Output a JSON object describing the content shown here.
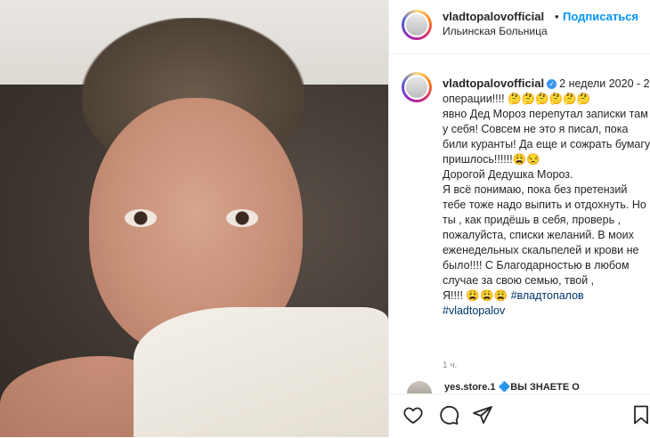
{
  "post": {
    "username": "vladtopalovofficial",
    "separator": "•",
    "follow_label": "Подписаться",
    "location": "Ильинская Больница",
    "caption_prefix": "2 недели 2020 - 2 операции!!!! 🤔🤔🤔🤔🤔🤔",
    "caption_body": "явно Дед Мороз перепутал записки там у себя! Совсем не это я писал, пока били куранты! Да еще и сожрать бумагу пришлось!!!!!!😩😒\nДорогой Дедушка Мороз.\nЯ всё понимаю, пока без претензий тебе тоже надо выпить и отдохнуть. Но ты , как придёшь в себя, проверь , пожалуйста, списки желаний. В моих еженедельных скальпелей и крови не было!!!! С Благодарностью в любом случае за свою семью, твой ,\nЯ!!!! 😩😩😩 ",
    "tag1": "#владтопалов",
    "tag2": "#vladtopalov",
    "time_ago": "1 ч."
  },
  "comment": {
    "username": "yes.store.1",
    "text": "🔷ВЫ ЗНАЕТЕ О"
  },
  "icons": {
    "like": "heart-icon",
    "comment": "comment-icon",
    "share": "share-icon",
    "save": "bookmark-icon"
  },
  "colors": {
    "link": "#0095f6",
    "hashtag": "#00376b",
    "verified": "#3897f0"
  }
}
